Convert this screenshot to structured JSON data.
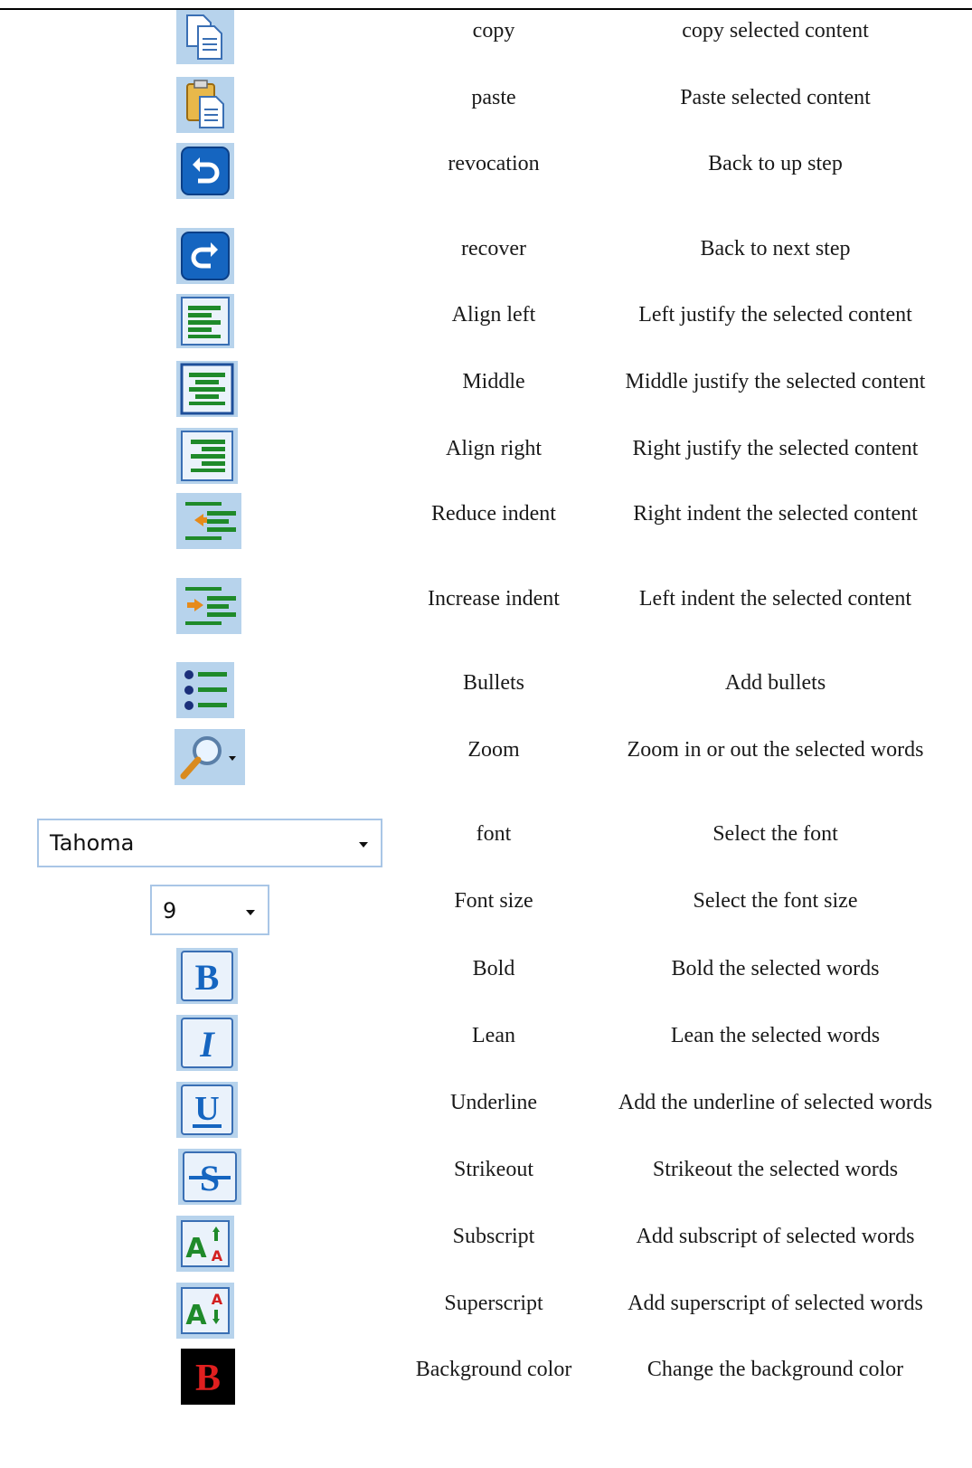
{
  "rows": [
    {
      "name": "copy",
      "desc": "copy selected content",
      "icon": "copy-icon"
    },
    {
      "name": "paste",
      "desc": "Paste selected content",
      "icon": "paste-icon"
    },
    {
      "name": "revocation",
      "desc": "Back to up step",
      "icon": "undo-icon"
    },
    {
      "name": "recover",
      "desc": "Back to next step",
      "icon": "redo-icon"
    },
    {
      "name": "Align left",
      "desc": "Left justify the selected content",
      "icon": "align-left-icon"
    },
    {
      "name": "Middle",
      "desc": "Middle justify the selected content",
      "icon": "align-center-icon"
    },
    {
      "name": "Align right",
      "desc": "Right justify the selected content",
      "icon": "align-right-icon"
    },
    {
      "name": "Reduce indent",
      "desc": "Right indent the selected content",
      "icon": "outdent-icon"
    },
    {
      "name": "Increase indent",
      "desc": "Left indent the selected content",
      "icon": "indent-icon"
    },
    {
      "name": "Bullets",
      "desc": "Add bullets",
      "icon": "bullets-icon"
    },
    {
      "name": "Zoom",
      "desc": "Zoom in or out the selected words",
      "icon": "zoom-icon"
    },
    {
      "name": "font",
      "desc": "Select the font",
      "icon": "font-combo"
    },
    {
      "name": "Font size",
      "desc": "Select the font size",
      "icon": "font-size-combo"
    },
    {
      "name": "Bold",
      "desc": "Bold the selected words",
      "icon": "bold-icon"
    },
    {
      "name": "Lean",
      "desc": "Lean the selected words",
      "icon": "italic-icon"
    },
    {
      "name": "Underline",
      "desc": "Add the underline of selected words",
      "icon": "underline-icon"
    },
    {
      "name": "Strikeout",
      "desc": "Strikeout the selected words",
      "icon": "strikeout-icon"
    },
    {
      "name": "Subscript",
      "desc": "Add subscript of selected words",
      "icon": "subscript-icon"
    },
    {
      "name": "Superscript",
      "desc": "Add superscript of selected words",
      "icon": "superscript-icon"
    },
    {
      "name": "Background color",
      "desc": "Change the background color",
      "icon": "background-color-icon"
    }
  ],
  "controls": {
    "font_value": "Tahoma",
    "font_size_value": "9"
  },
  "colors": {
    "tile": "#b7d3ec",
    "align_green": "#1f8a2a",
    "button_blue": "#1565c0",
    "background_color_red": "#e01f1f"
  }
}
